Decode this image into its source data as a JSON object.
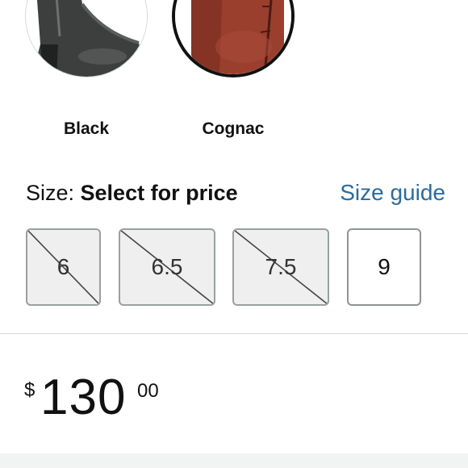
{
  "colors": {
    "options": [
      {
        "label": "Black",
        "selected": false
      },
      {
        "label": "Cognac",
        "selected": true
      }
    ]
  },
  "size": {
    "prefix": "Size: ",
    "value": "Select for price",
    "guide_link": "Size guide",
    "options": [
      {
        "label": "6",
        "available": false
      },
      {
        "label": "6.5",
        "available": false
      },
      {
        "label": "7.5",
        "available": false
      },
      {
        "label": "9",
        "available": true
      }
    ]
  },
  "price": {
    "currency_symbol": "$",
    "whole": "130",
    "fraction": "00"
  },
  "theme": {
    "link_color": "#2b6b9e",
    "selected_border": "#111111",
    "unavailable_bg": "#efefef"
  }
}
